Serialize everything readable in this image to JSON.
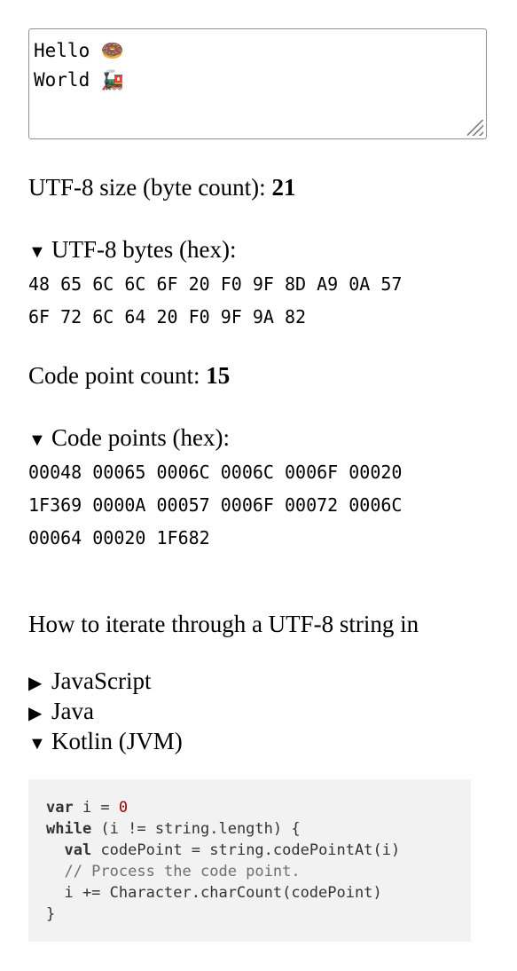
{
  "textarea": {
    "lines": [
      "Hello 🍩",
      "World 🚂"
    ]
  },
  "utf8_size": {
    "label": "UTF-8 size (byte count): ",
    "value": "21"
  },
  "utf8_bytes": {
    "label": "UTF-8 bytes (hex):",
    "lines": [
      "48 65 6C 6C 6F 20 F0 9F 8D A9 0A 57",
      "6F 72 6C 64 20 F0 9F 9A 82"
    ]
  },
  "code_point_count": {
    "label": "Code point count: ",
    "value": "15"
  },
  "code_points": {
    "label": "Code points (hex):",
    "lines": [
      "00048 00065 0006C 0006C 0006F 00020",
      "1F369 0000A 00057 0006F 00072 0006C",
      "00064 00020 1F682"
    ]
  },
  "iterate_heading": "How to iterate through a UTF-8 string in",
  "languages": [
    {
      "label": "JavaScript",
      "expanded": false
    },
    {
      "label": "Java",
      "expanded": false
    },
    {
      "label": "Kotlin (JVM)",
      "expanded": true
    }
  ],
  "code": {
    "l1_kw": "var",
    "l1_rest": " i = ",
    "l1_num": "0",
    "l2_kw": "while",
    "l2_rest": " (i != string.length) {",
    "l3_indent": "  ",
    "l3_kw": "val",
    "l3_rest": " codePoint = string.codePointAt(i)",
    "l4": "  // Process the code point.",
    "l5": "  i += Character.charCount(codePoint)",
    "l6": "}"
  },
  "colors": {
    "code_bg": "#f2f2f2",
    "number": "#990000",
    "comment": "#6f6f6f"
  }
}
